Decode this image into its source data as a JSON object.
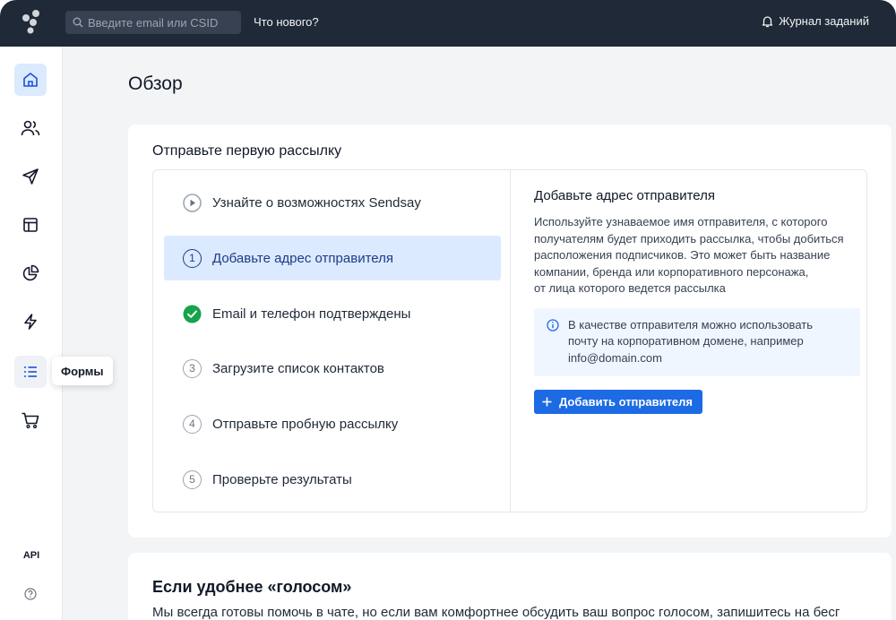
{
  "topbar": {
    "search_placeholder": "Введите email или CSID",
    "whats_new": "Что нового?",
    "journal": "Журнал заданий"
  },
  "sidebar": {
    "items": [
      {
        "icon": "home-icon",
        "active": true
      },
      {
        "icon": "users-icon"
      },
      {
        "icon": "send-icon"
      },
      {
        "icon": "layout-icon"
      },
      {
        "icon": "pie-chart-icon"
      },
      {
        "icon": "lightning-icon"
      },
      {
        "icon": "list-icon",
        "hover": true
      },
      {
        "icon": "cart-icon"
      }
    ],
    "tooltip": "Формы",
    "api_label": "API"
  },
  "main": {
    "title": "Обзор",
    "onboarding": {
      "title": "Отправьте первую рассылку",
      "steps": [
        {
          "marker": "play",
          "label": "Узнайте о возможностях Sendsay"
        },
        {
          "marker": "1",
          "label": "Добавьте адрес отправителя"
        },
        {
          "marker": "check",
          "label": "Email и телефон подтверждены"
        },
        {
          "marker": "3",
          "label": "Загрузите список контактов"
        },
        {
          "marker": "4",
          "label": "Отправьте пробную рассылку"
        },
        {
          "marker": "5",
          "label": "Проверьте результаты"
        }
      ],
      "detail": {
        "title": "Добавьте адрес отправителя",
        "description": "Используйте узнаваемое имя отправителя, с которого\nполучателям будет приходить рассылка, чтобы добиться\nрасположения подписчиков. Это может быть название\nкомпании, бренда или корпоративного персонажа,\nот лица которого ведется рассылка",
        "info": "В качестве отправителя можно использовать\nпочту на корпоративном домене, например\ninfo@domain.com",
        "button": "Добавить отправителя"
      }
    },
    "voice": {
      "title": "Если удобнее «голосом»",
      "text": "Мы всегда готовы помочь в чате, но если вам комфортнее обсудить ваш вопрос голосом, запишитесь на бесг"
    }
  },
  "colors": {
    "topbar": "#1f2937",
    "accent": "#1d6ae5",
    "active_bg": "#dbeafe",
    "success": "#16a34a"
  }
}
